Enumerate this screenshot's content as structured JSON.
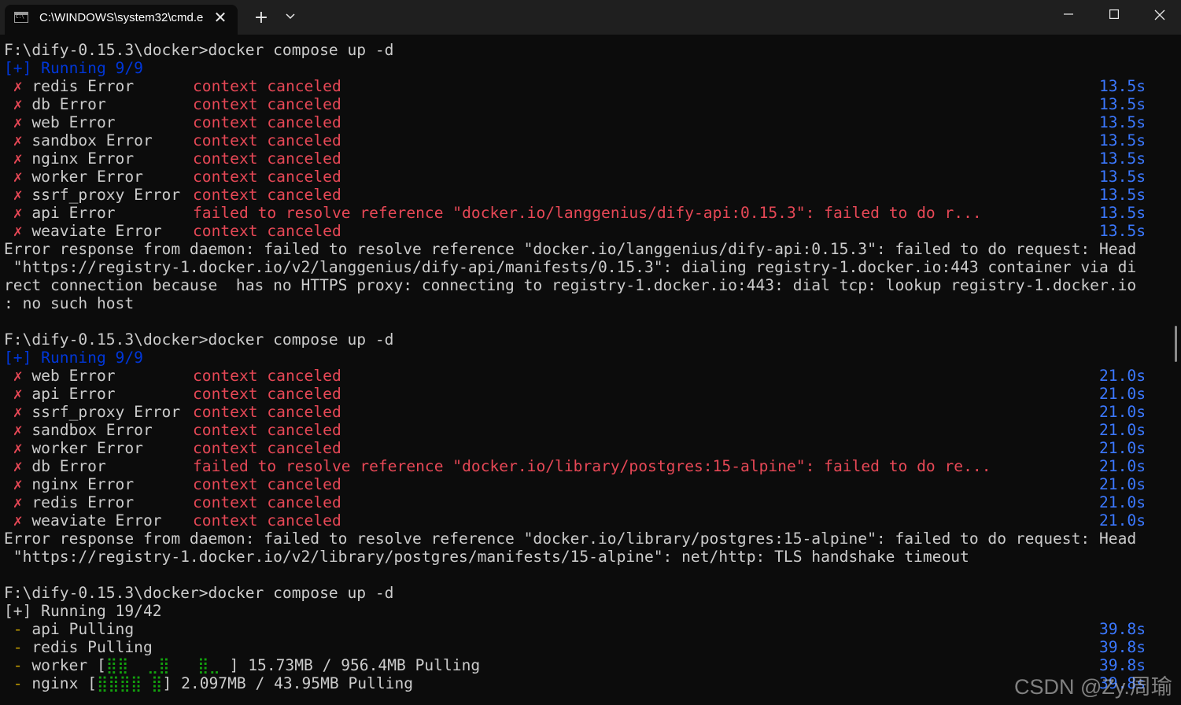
{
  "titlebar": {
    "tab_title": "C:\\WINDOWS\\system32\\cmd.e",
    "tab_close": "✕",
    "new_tab": "+"
  },
  "colors": {
    "background": "#0c0c0c",
    "titlebar": "#1f1f1f",
    "text": "#cccccc",
    "error_red": "#e74856",
    "time_blue": "#3b78ff",
    "running_blue": "#0037da",
    "pull_yellow": "#c19c00",
    "progress_green": "#13a10e"
  },
  "terminal": {
    "run1": {
      "prompt": "F:\\dify-0.15.3\\docker>docker compose up -d",
      "status": "[+] Running 9/9",
      "services": [
        {
          "name": "redis Error",
          "msg": "context canceled",
          "time": "13.5s"
        },
        {
          "name": "db Error",
          "msg": "context canceled",
          "time": "13.5s"
        },
        {
          "name": "web Error",
          "msg": "context canceled",
          "time": "13.5s"
        },
        {
          "name": "sandbox Error",
          "msg": "context canceled",
          "time": "13.5s"
        },
        {
          "name": "nginx Error",
          "msg": "context canceled",
          "time": "13.5s"
        },
        {
          "name": "worker Error",
          "msg": "context canceled",
          "time": "13.5s"
        },
        {
          "name": "ssrf_proxy Error",
          "msg": "context canceled",
          "time": "13.5s"
        },
        {
          "name": "api Error",
          "msg": "failed to resolve reference \"docker.io/langgenius/dify-api:0.15.3\": failed to do r...",
          "time": "13.5s"
        },
        {
          "name": "weaviate Error",
          "msg": "context canceled",
          "time": "13.5s"
        }
      ],
      "error_lines": [
        "Error response from daemon: failed to resolve reference \"docker.io/langgenius/dify-api:0.15.3\": failed to do request: Head",
        " \"https://registry-1.docker.io/v2/langgenius/dify-api/manifests/0.15.3\": dialing registry-1.docker.io:443 container via di",
        "rect connection because  has no HTTPS proxy: connecting to registry-1.docker.io:443: dial tcp: lookup registry-1.docker.io",
        ": no such host"
      ]
    },
    "run2": {
      "prompt": "F:\\dify-0.15.3\\docker>docker compose up -d",
      "status": "[+] Running 9/9",
      "services": [
        {
          "name": "web Error",
          "msg": "context canceled",
          "time": "21.0s"
        },
        {
          "name": "api Error",
          "msg": "context canceled",
          "time": "21.0s"
        },
        {
          "name": "ssrf_proxy Error",
          "msg": "context canceled",
          "time": "21.0s"
        },
        {
          "name": "sandbox Error",
          "msg": "context canceled",
          "time": "21.0s"
        },
        {
          "name": "worker Error",
          "msg": "context canceled",
          "time": "21.0s"
        },
        {
          "name": "db Error",
          "msg": "failed to resolve reference \"docker.io/library/postgres:15-alpine\": failed to do re...",
          "time": "21.0s"
        },
        {
          "name": "nginx Error",
          "msg": "context canceled",
          "time": "21.0s"
        },
        {
          "name": "redis Error",
          "msg": "context canceled",
          "time": "21.0s"
        },
        {
          "name": "weaviate Error",
          "msg": "context canceled",
          "time": "21.0s"
        }
      ],
      "error_lines": [
        "Error response from daemon: failed to resolve reference \"docker.io/library/postgres:15-alpine\": failed to do request: Head",
        " \"https://registry-1.docker.io/v2/library/postgres/manifests/15-alpine\": net/http: TLS handshake timeout"
      ]
    },
    "run3": {
      "prompt": "F:\\dify-0.15.3\\docker>docker compose up -d",
      "status": "[+] Running 19/42",
      "pulls": [
        {
          "name": "api Pulling",
          "time": "39.8s"
        },
        {
          "name": "redis Pulling",
          "time": "39.8s"
        },
        {
          "name": "worker [",
          "bar": "⣿⣿  ⣀⣿   ⣿⣀ ",
          "tail": "] 15.73MB / 956.4MB Pulling",
          "time": "39.8s"
        },
        {
          "name": "nginx [",
          "bar": "⣿⣿⣿⣿ ⣿",
          "tail": "] 2.097MB / 43.95MB Pulling",
          "time": "39.8s"
        }
      ]
    },
    "error_mark": "✗",
    "pull_mark": "-"
  },
  "watermark": "CSDN @Zy.周瑜"
}
